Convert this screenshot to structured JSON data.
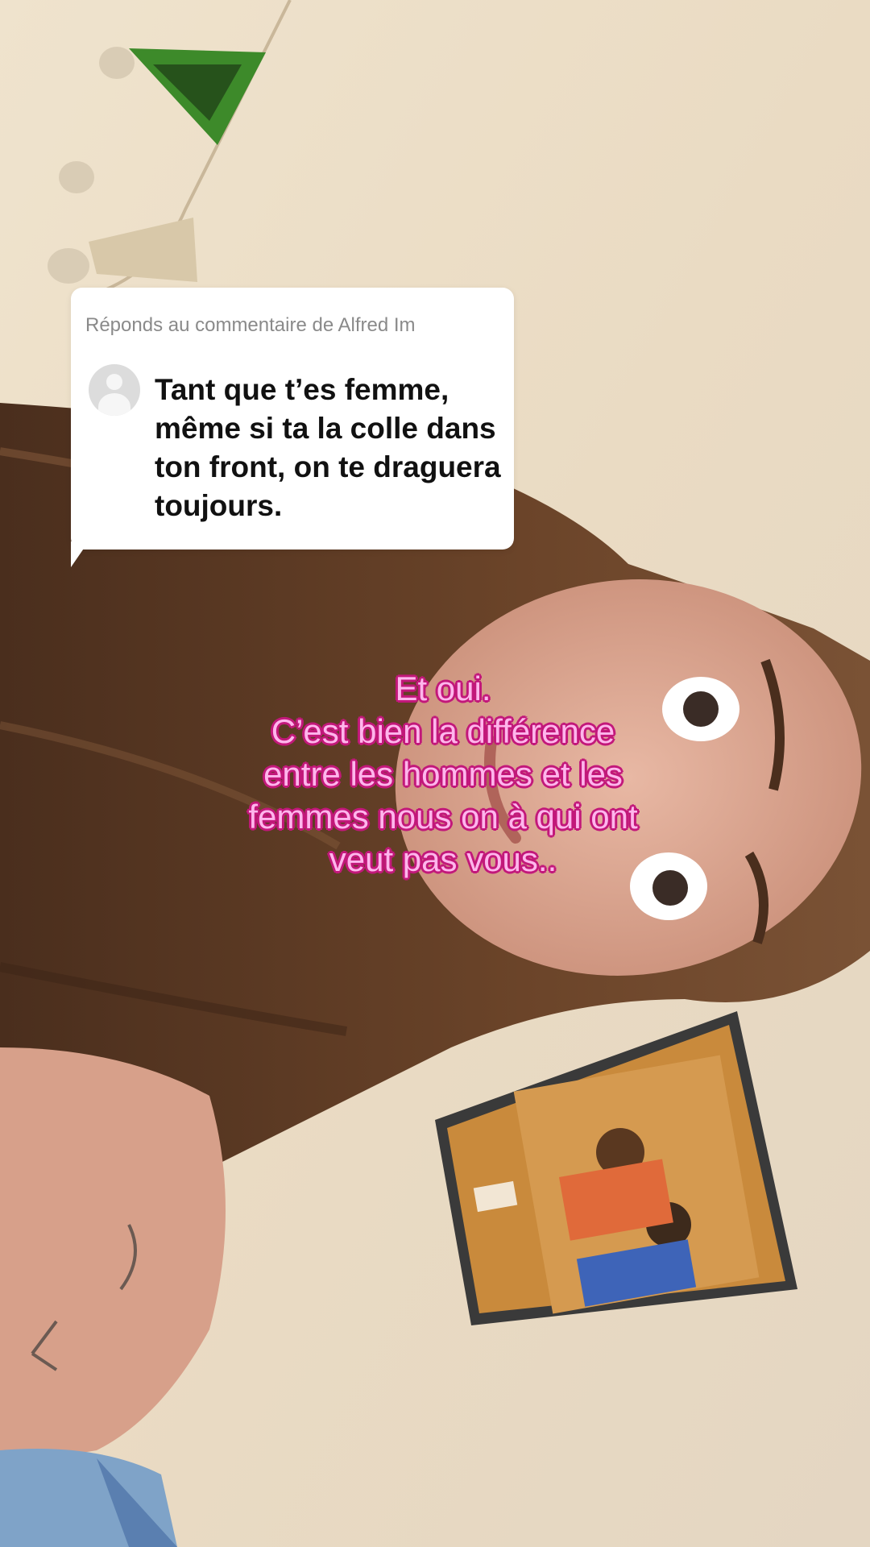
{
  "reply": {
    "header": "Réponds au commentaire de Alfred Im",
    "text": "Tant que t’es femme, même si ta la colle dans ton front, on te draguera toujours."
  },
  "caption": {
    "lines": [
      "Et oui.",
      "C’est bien la différence",
      "entre les hommes et les",
      "femmes nous on à qui ont",
      "veut pas vous.."
    ]
  },
  "colors": {
    "caption_fill": "#ffb6ec",
    "caption_outline": "#c2187a",
    "card_bg": "#ffffff"
  },
  "icons": {
    "avatar": "default-user-avatar-icon"
  }
}
